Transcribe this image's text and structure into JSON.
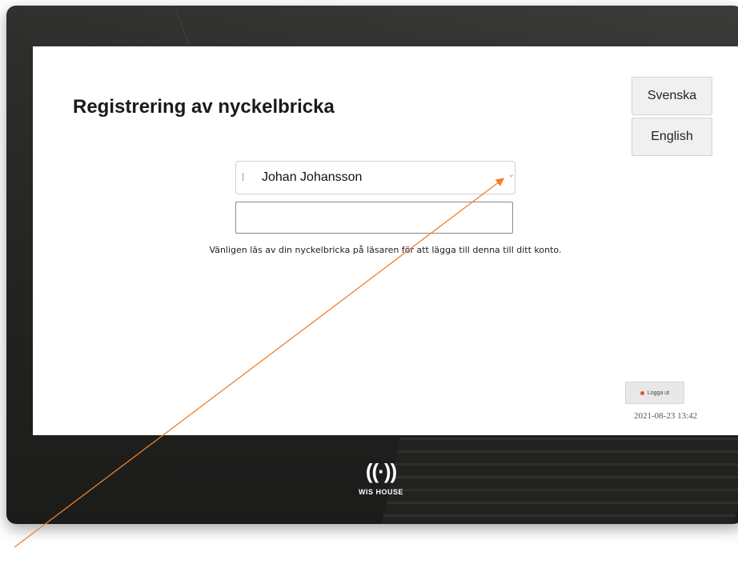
{
  "page": {
    "title": "Registrering av nyckelbricka"
  },
  "language": {
    "options": [
      "Svenska",
      "English"
    ]
  },
  "user_select": {
    "selected": "Johan Johansson"
  },
  "tag_input": {
    "value": ""
  },
  "instruction": "Vänligen läs av din nyckelbricka på läsaren för att lägga till denna till ditt konto.",
  "logout": {
    "label": "Logga ut"
  },
  "timestamp": "2021-08-23 13:42",
  "brand": {
    "waves": "((·))",
    "name": "WIS HOUSE"
  },
  "colors": {
    "annotation_arrow": "#f07f2c",
    "logout_dot": "#e0531f"
  }
}
